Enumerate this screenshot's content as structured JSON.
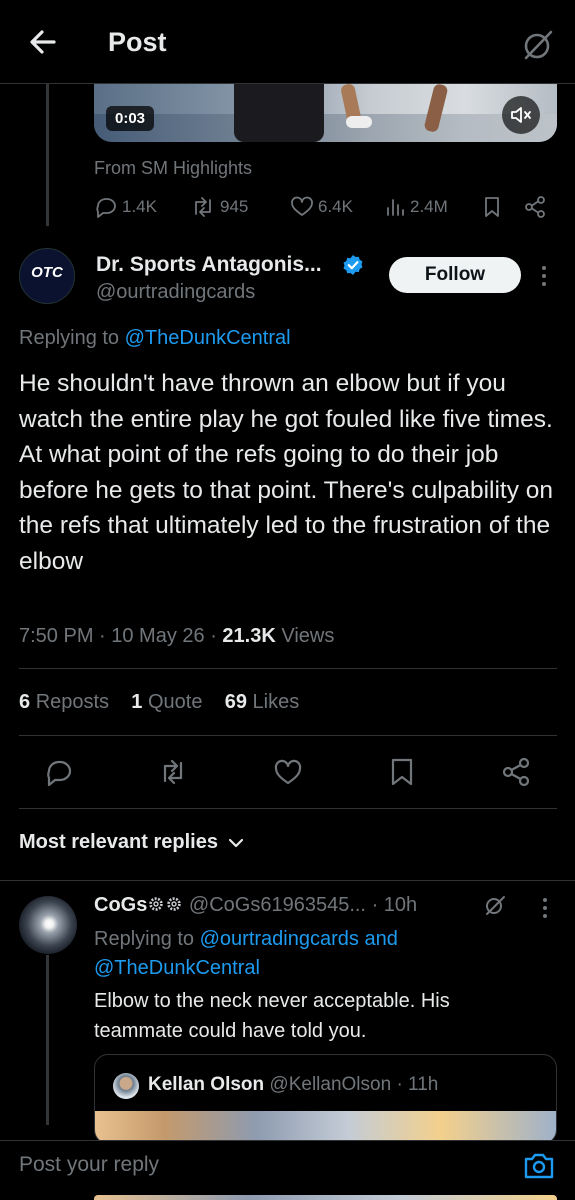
{
  "header": {
    "title": "Post"
  },
  "previous_post": {
    "video_time": "0:03",
    "source": "From SM Highlights",
    "metrics": {
      "replies": "1.4K",
      "reposts": "945",
      "likes": "6.4K",
      "views": "2.4M"
    }
  },
  "post": {
    "avatar_text": "OTC",
    "author_name": "Dr. Sports Antagonis...",
    "author_handle": "@ourtradingcards",
    "follow_label": "Follow",
    "replying_prefix": "Replying to",
    "replying_to": "@TheDunkCentral",
    "text": "He shouldn't have thrown an elbow but if you watch the entire play he got fouled like five times. At what point of the refs going to do their job before he gets to that point. There's culpability on the refs that ultimately led to the frustration of the elbow",
    "timestamp": "7:50 PM · 10 May 26 · ",
    "views_count": "21.3K",
    "views_label": " Views",
    "stats": {
      "reposts_count": "6",
      "reposts_label": "Reposts",
      "quotes_count": "1",
      "quotes_label": "Quote",
      "likes_count": "69",
      "likes_label": "Likes"
    }
  },
  "replies_section": {
    "label": "Most relevant replies"
  },
  "reply": {
    "author_name": "CoGs",
    "author_handle": "@CoGs61963545...",
    "time": "· 10h",
    "replying_prefix": "Replying to",
    "replying_to": "@ourtradingcards and @TheDunkCentral",
    "text": "Elbow to the neck never acceptable. His teammate could have told you.",
    "quote": {
      "author_name": "Kellan Olson",
      "author_handle": "@KellanOlson",
      "time": "· 11h"
    }
  },
  "compose": {
    "placeholder": "Post your reply"
  },
  "colors": {
    "background": "#000000",
    "text": "#e7e9ea",
    "muted": "#71767b",
    "accent": "#1d9bf0",
    "divider": "#2f3336"
  }
}
